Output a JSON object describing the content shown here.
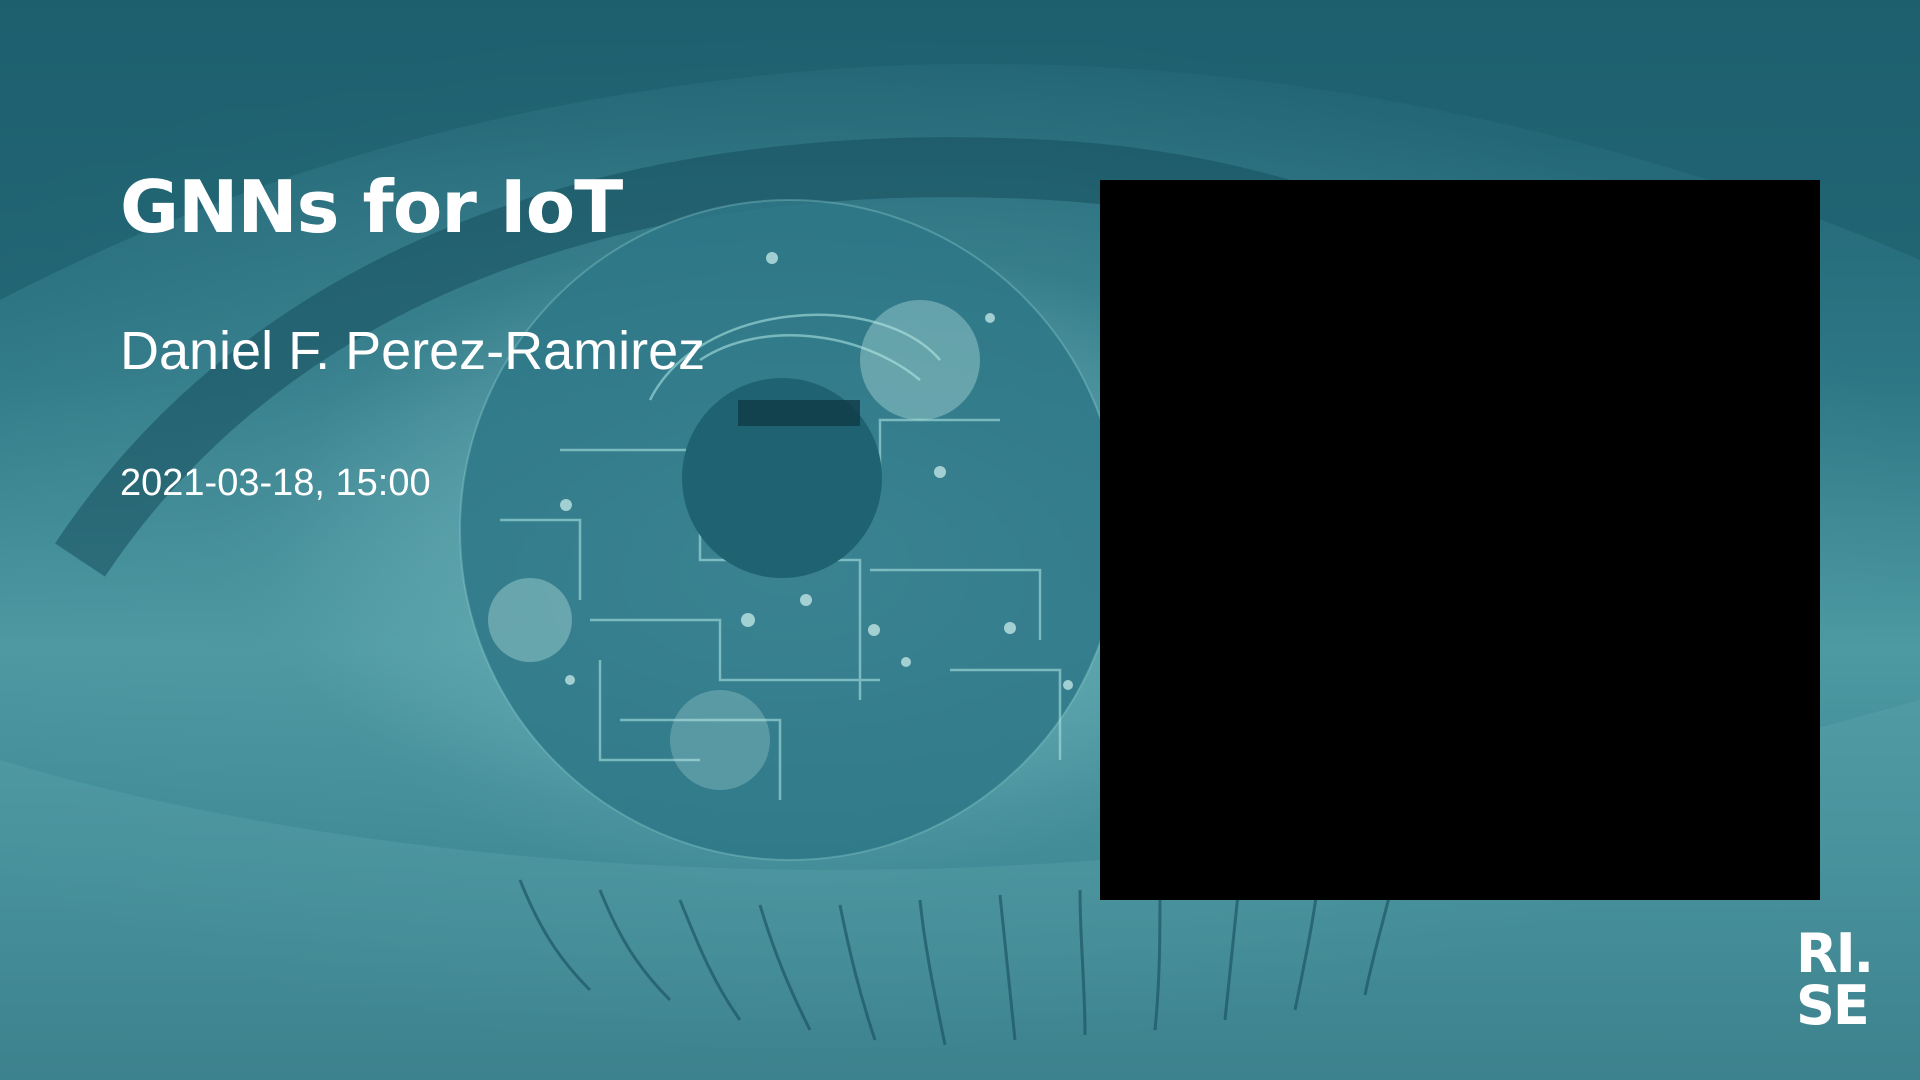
{
  "slide": {
    "title": "GNNs for IoT",
    "presenter": "Daniel F. Perez-Ramirez",
    "datetime": "2021-03-18, 15:00"
  },
  "logo": {
    "line1": "RI.",
    "line2": "SE"
  },
  "colors": {
    "background_teal": "#2d7382",
    "text": "#ffffff",
    "video_box": "#000000"
  },
  "background_image": "eye-with-circuit-brain-iris"
}
